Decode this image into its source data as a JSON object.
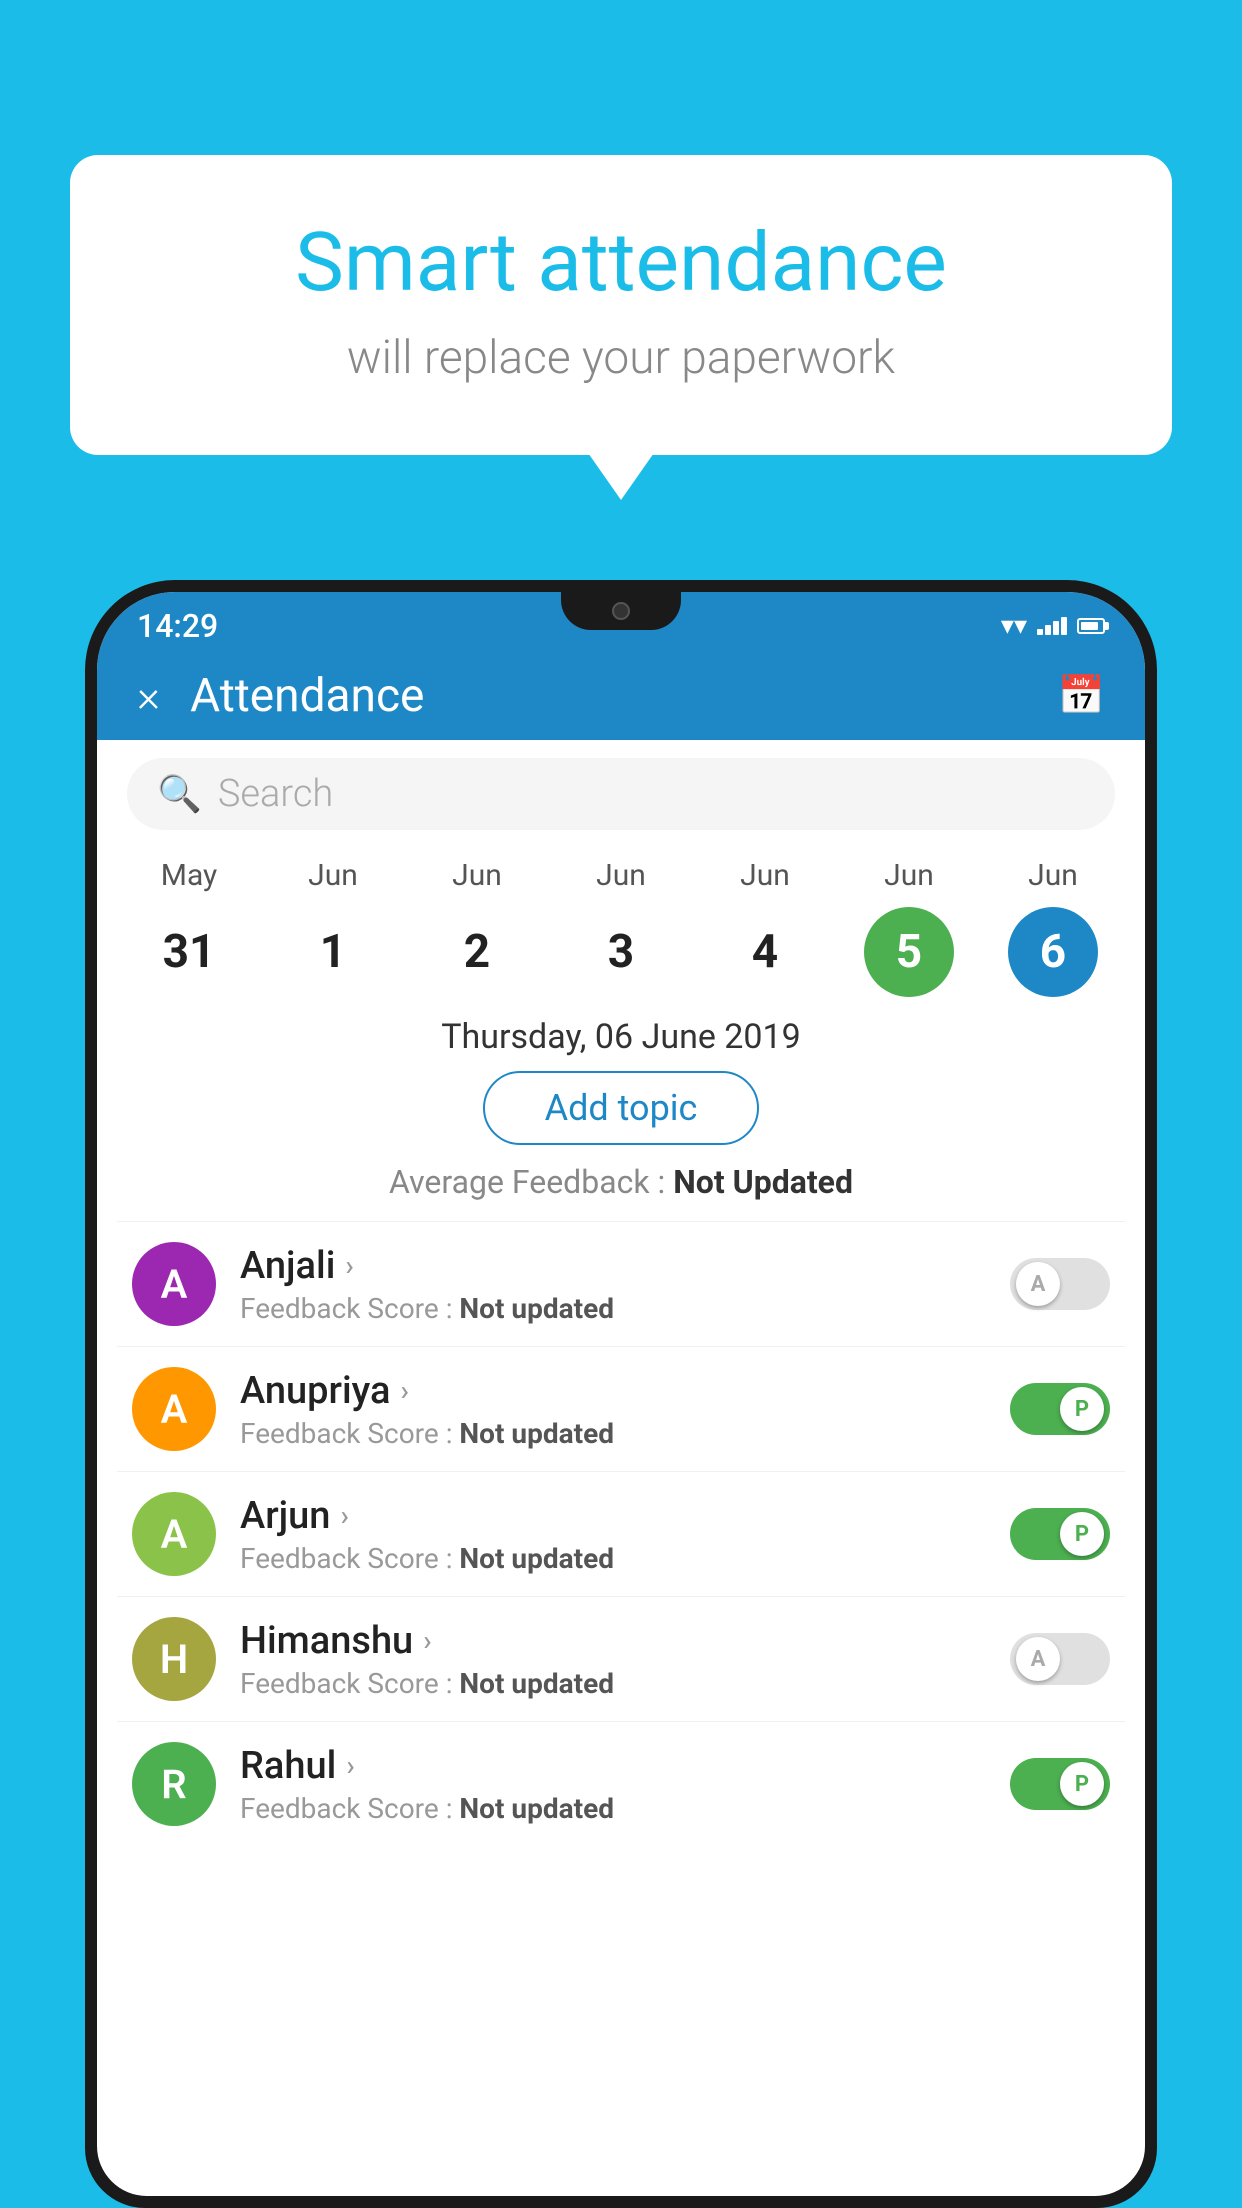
{
  "background_color": "#1bbde8",
  "bubble": {
    "title": "Smart attendance",
    "subtitle": "will replace your paperwork"
  },
  "phone": {
    "status_bar": {
      "time": "14:29"
    },
    "header": {
      "title": "Attendance",
      "close_label": "×",
      "calendar_icon": "calendar-icon"
    },
    "search": {
      "placeholder": "Search"
    },
    "calendar": {
      "days": [
        {
          "month": "May",
          "date": "31",
          "state": "normal"
        },
        {
          "month": "Jun",
          "date": "1",
          "state": "normal"
        },
        {
          "month": "Jun",
          "date": "2",
          "state": "normal"
        },
        {
          "month": "Jun",
          "date": "3",
          "state": "normal"
        },
        {
          "month": "Jun",
          "date": "4",
          "state": "normal"
        },
        {
          "month": "Jun",
          "date": "5",
          "state": "today"
        },
        {
          "month": "Jun",
          "date": "6",
          "state": "selected"
        }
      ]
    },
    "selected_date": "Thursday, 06 June 2019",
    "add_topic_label": "Add topic",
    "avg_feedback_label": "Average Feedback :",
    "avg_feedback_value": "Not Updated",
    "students": [
      {
        "name": "Anjali",
        "avatar_letter": "A",
        "avatar_color": "purple",
        "feedback_label": "Feedback Score :",
        "feedback_value": "Not updated",
        "toggle_state": "off",
        "toggle_label": "A"
      },
      {
        "name": "Anupriya",
        "avatar_letter": "A",
        "avatar_color": "orange",
        "feedback_label": "Feedback Score :",
        "feedback_value": "Not updated",
        "toggle_state": "on",
        "toggle_label": "P"
      },
      {
        "name": "Arjun",
        "avatar_letter": "A",
        "avatar_color": "light-green",
        "feedback_label": "Feedback Score :",
        "feedback_value": "Not updated",
        "toggle_state": "on",
        "toggle_label": "P"
      },
      {
        "name": "Himanshu",
        "avatar_letter": "H",
        "avatar_color": "khaki",
        "feedback_label": "Feedback Score :",
        "feedback_value": "Not updated",
        "toggle_state": "off",
        "toggle_label": "A"
      },
      {
        "name": "Rahul",
        "avatar_letter": "R",
        "avatar_color": "green",
        "feedback_label": "Feedback Score :",
        "feedback_value": "Not updated",
        "toggle_state": "on",
        "toggle_label": "P"
      }
    ]
  }
}
